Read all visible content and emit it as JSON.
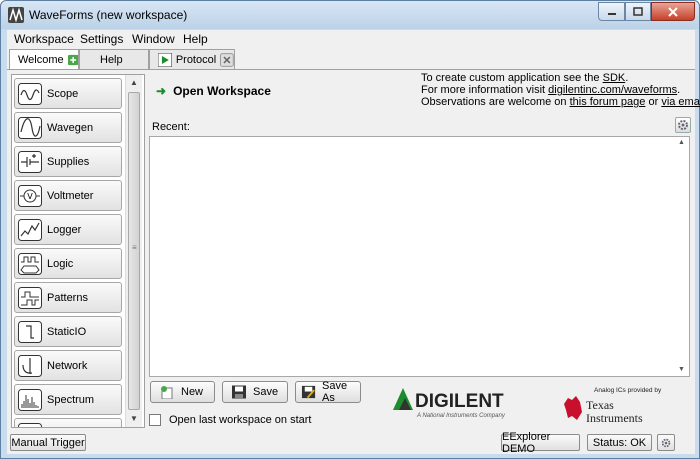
{
  "window": {
    "title": "WaveForms  (new workspace)"
  },
  "menu": [
    "Workspace",
    "Settings",
    "Window",
    "Help"
  ],
  "tabs": [
    {
      "label": "Welcome"
    },
    {
      "label": "Help"
    },
    {
      "label": "Protocol"
    }
  ],
  "sidebar": {
    "items": [
      {
        "label": "Scope",
        "icon": "scope-icon"
      },
      {
        "label": "Wavegen",
        "icon": "wavegen-icon"
      },
      {
        "label": "Supplies",
        "icon": "supplies-icon"
      },
      {
        "label": "Voltmeter",
        "icon": "voltmeter-icon"
      },
      {
        "label": "Logger",
        "icon": "logger-icon"
      },
      {
        "label": "Logic",
        "icon": "logic-icon"
      },
      {
        "label": "Patterns",
        "icon": "patterns-icon"
      },
      {
        "label": "StaticIO",
        "icon": "staticio-icon"
      },
      {
        "label": "Network",
        "icon": "network-icon"
      },
      {
        "label": "Spectrum",
        "icon": "spectrum-icon"
      }
    ]
  },
  "main": {
    "open_workspace": "Open Workspace",
    "info": {
      "line1_prefix": "To create custom application see the ",
      "line1_link": "SDK",
      "line1_suffix": ".",
      "line2_prefix": "For more information visit ",
      "line2_link": "digilentinc.com/waveforms",
      "line2_suffix": ".",
      "line3_prefix": "Observations are welcome on ",
      "line3_link1": "this forum page",
      "line3_mid": " or ",
      "line3_link2": "via email",
      "line3_suffix": "."
    },
    "recent_label": "Recent:",
    "buttons": {
      "new": "New",
      "save": "Save",
      "save_as": "Save As"
    },
    "open_last_label": "Open last workspace on start",
    "open_last_checked": false,
    "digilent_logo": "DIGILENT",
    "digilent_sub": "A National Instruments Company",
    "ti_caption": "Analog ICs provided by",
    "ti_line1": "Texas",
    "ti_line2": "Instruments"
  },
  "statusbar": {
    "manual_trigger": "Manual Trigger",
    "device": "EExplorer DEMO",
    "status": "Status: OK"
  },
  "colors": {
    "title_bar": "#c9dced",
    "close_button": "#c7402a",
    "accent_green": "#1d8c2e",
    "ti_red": "#c8102e"
  }
}
